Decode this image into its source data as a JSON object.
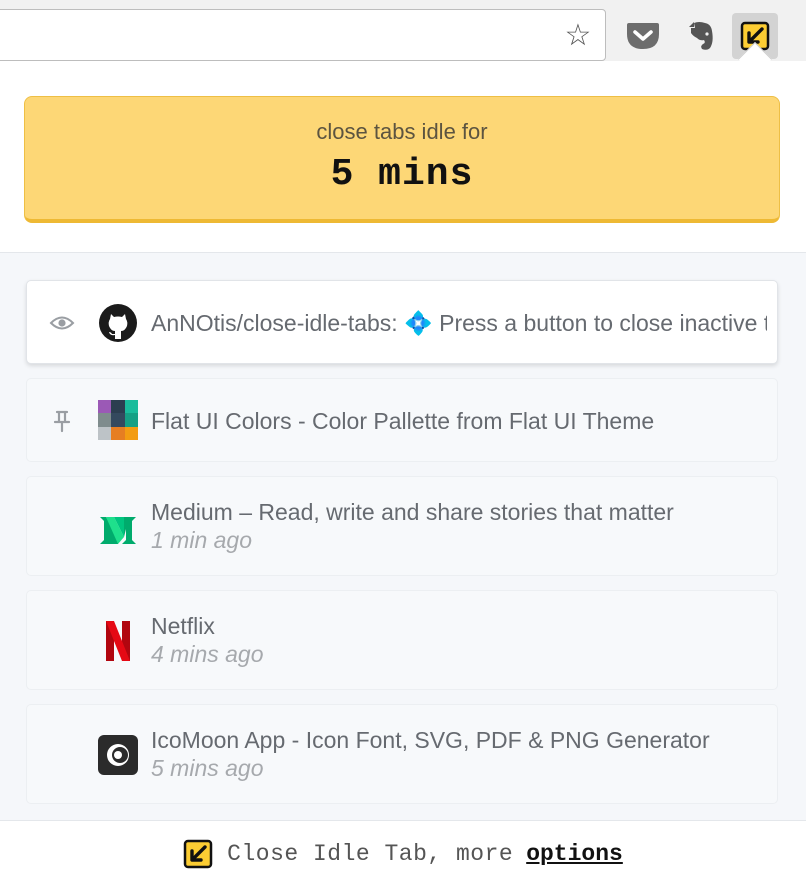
{
  "toolbar": {
    "icons": [
      "star-icon",
      "pocket-icon",
      "evernote-icon",
      "close-idle-tab-icon"
    ]
  },
  "popup": {
    "idle_label": "close tabs idle for",
    "idle_value": "5 mins",
    "accent_color": "#fdd776",
    "tabs": [
      {
        "state_icon": "eye-icon",
        "favicon": "github-icon",
        "title": "AnNOtis/close-idle-tabs: 💠 Press a button to close inactive tabs",
        "ago": "",
        "active": true
      },
      {
        "state_icon": "pin-icon",
        "favicon": "flat-ui-colors-icon",
        "title": "Flat UI Colors - Color Pallette from Flat UI Theme",
        "ago": ""
      },
      {
        "state_icon": "",
        "favicon": "medium-icon",
        "title": "Medium – Read, write and share stories that matter",
        "ago": "1 min ago"
      },
      {
        "state_icon": "",
        "favicon": "netflix-icon",
        "title": "Netflix",
        "ago": "4 mins ago"
      },
      {
        "state_icon": "",
        "favicon": "icomoon-icon",
        "title": "IcoMoon App - Icon Font, SVG, PDF & PNG Generator",
        "ago": "5 mins ago"
      }
    ],
    "footer": {
      "text": "Close Idle Tab, more",
      "link": "options"
    }
  }
}
